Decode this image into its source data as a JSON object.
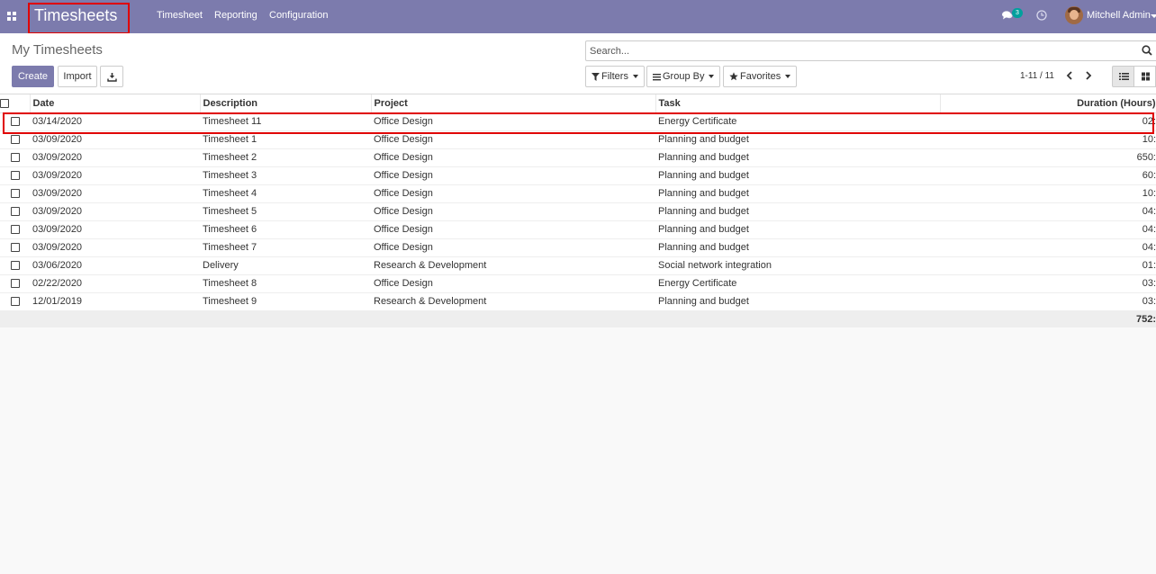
{
  "navbar": {
    "brand": "Timesheets",
    "menu": [
      "Timesheet",
      "Reporting",
      "Configuration"
    ],
    "chat_count": "3",
    "user_name": "Mitchell Admin"
  },
  "control_panel": {
    "title": "My Timesheets",
    "create_label": "Create",
    "import_label": "Import",
    "search_placeholder": "Search...",
    "filters_label": "Filters",
    "group_by_label": "Group By",
    "favorites_label": "Favorites",
    "pager": "1-11 / 11"
  },
  "table": {
    "columns": [
      "Date",
      "Description",
      "Project",
      "Task",
      "Duration (Hours)"
    ],
    "rows": [
      {
        "date": "03/14/2020",
        "description": "Timesheet 11",
        "project": "Office Design",
        "task": "Energy Certificate",
        "duration": "02:"
      },
      {
        "date": "03/09/2020",
        "description": "Timesheet 1",
        "project": "Office Design",
        "task": "Planning and budget",
        "duration": "10:"
      },
      {
        "date": "03/09/2020",
        "description": "Timesheet 2",
        "project": "Office Design",
        "task": "Planning and budget",
        "duration": "650:"
      },
      {
        "date": "03/09/2020",
        "description": "Timesheet 3",
        "project": "Office Design",
        "task": "Planning and budget",
        "duration": "60:"
      },
      {
        "date": "03/09/2020",
        "description": "Timesheet 4",
        "project": "Office Design",
        "task": "Planning and budget",
        "duration": "10:"
      },
      {
        "date": "03/09/2020",
        "description": "Timesheet 5",
        "project": "Office Design",
        "task": "Planning and budget",
        "duration": "04:"
      },
      {
        "date": "03/09/2020",
        "description": "Timesheet 6",
        "project": "Office Design",
        "task": "Planning and budget",
        "duration": "04:"
      },
      {
        "date": "03/09/2020",
        "description": "Timesheet 7",
        "project": "Office Design",
        "task": "Planning and budget",
        "duration": "04:"
      },
      {
        "date": "03/06/2020",
        "description": "Delivery",
        "project": "Research & Development",
        "task": "Social network integration",
        "duration": "01:"
      },
      {
        "date": "02/22/2020",
        "description": "Timesheet 8",
        "project": "Office Design",
        "task": "Energy Certificate",
        "duration": "03:"
      },
      {
        "date": "12/01/2019",
        "description": "Timesheet 9",
        "project": "Research & Development",
        "task": "Planning and budget",
        "duration": "03:"
      }
    ],
    "total": "752:"
  },
  "icons": {
    "apps": "apps-grid-icon",
    "chat": "chat-bubble-icon",
    "activity": "clock-icon",
    "search": "search-icon",
    "download": "download-icon",
    "filter": "filter-icon",
    "group_by": "bars-icon",
    "favorites": "star-icon",
    "pager_prev": "chevron-left-icon",
    "pager_next": "chevron-right-icon",
    "list_view": "list-icon",
    "kanban_view": "kanban-icon"
  },
  "colors": {
    "navbar": "#7c7bad",
    "primary": "#7c7bad",
    "badge": "#00a09d",
    "highlight": "#e00000"
  }
}
